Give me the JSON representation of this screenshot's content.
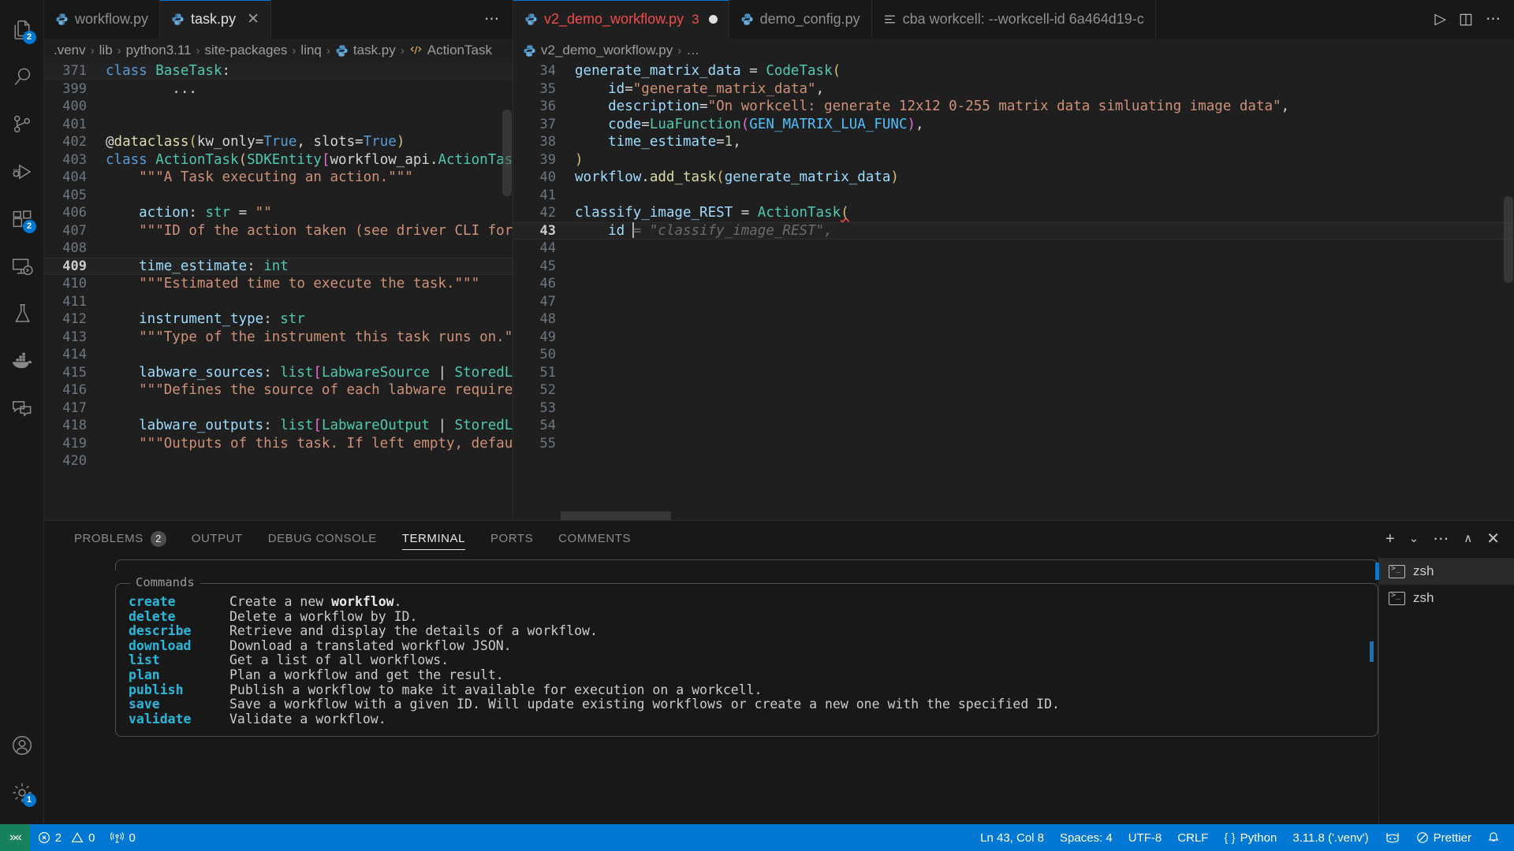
{
  "activity_bar": {
    "top_items": [
      {
        "name": "explorer",
        "icon": "files-icon",
        "badge": "2",
        "active": false
      },
      {
        "name": "search",
        "icon": "search-icon",
        "badge": null,
        "active": false
      },
      {
        "name": "source-control",
        "icon": "source-control-icon",
        "badge": null,
        "active": false
      },
      {
        "name": "run-and-debug",
        "icon": "run-debug-icon",
        "badge": null,
        "active": false
      },
      {
        "name": "extensions",
        "icon": "extensions-icon",
        "badge": "2",
        "active": false
      },
      {
        "name": "remote-explorer",
        "icon": "remote-explorer-icon",
        "badge": null,
        "active": false
      },
      {
        "name": "testing",
        "icon": "beaker-icon",
        "badge": null,
        "active": false
      },
      {
        "name": "docker",
        "icon": "docker-icon",
        "badge": null,
        "active": false
      },
      {
        "name": "chat",
        "icon": "chat-icon",
        "badge": null,
        "active": false
      }
    ],
    "bottom_items": [
      {
        "name": "accounts",
        "icon": "account-icon",
        "badge": null
      },
      {
        "name": "manage-settings",
        "icon": "gear-icon",
        "badge": "1"
      }
    ]
  },
  "left_group": {
    "tabs": [
      {
        "label": "workflow.py",
        "icon": "python-icon",
        "active": false,
        "dirty": false,
        "closable": false
      },
      {
        "label": "task.py",
        "icon": "python-icon",
        "active": true,
        "dirty": false,
        "closable": true,
        "close_glyph": "✕"
      }
    ],
    "overflow_glyph": "⋯",
    "breadcrumbs": [
      {
        "label": ".venv",
        "icon": null
      },
      {
        "label": "lib",
        "icon": null
      },
      {
        "label": "python3.11",
        "icon": null
      },
      {
        "label": "site-packages",
        "icon": null
      },
      {
        "label": "linq",
        "icon": null
      },
      {
        "label": "task.py",
        "icon": "python-icon"
      },
      {
        "label": "ActionTask",
        "icon": "class-icon"
      }
    ],
    "breadcrumb_separator": "›",
    "lines": [
      {
        "no": "371",
        "sticky": true,
        "tokens": [
          {
            "t": "class ",
            "c": "t-kw"
          },
          {
            "t": "BaseTask",
            "c": "t-cls"
          },
          {
            "t": ":",
            "c": "t-plain"
          }
        ]
      },
      {
        "no": "399",
        "tokens": [
          {
            "t": "        ...",
            "c": "t-plain"
          }
        ]
      },
      {
        "no": "400",
        "tokens": []
      },
      {
        "no": "401",
        "tokens": []
      },
      {
        "no": "402",
        "tokens": [
          {
            "t": "@",
            "c": "t-plain"
          },
          {
            "t": "dataclass",
            "c": "t-fn"
          },
          {
            "t": "(",
            "c": "t-par"
          },
          {
            "t": "kw_only",
            "c": "t-plain"
          },
          {
            "t": "=",
            "c": "t-plain"
          },
          {
            "t": "True",
            "c": "t-kw"
          },
          {
            "t": ", ",
            "c": "t-plain"
          },
          {
            "t": "slots",
            "c": "t-plain"
          },
          {
            "t": "=",
            "c": "t-plain"
          },
          {
            "t": "True",
            "c": "t-kw"
          },
          {
            "t": ")",
            "c": "t-par"
          }
        ]
      },
      {
        "no": "403",
        "tokens": [
          {
            "t": "class ",
            "c": "t-kw"
          },
          {
            "t": "ActionTask",
            "c": "t-cls"
          },
          {
            "t": "(",
            "c": "t-par"
          },
          {
            "t": "SDKEntity",
            "c": "t-cls"
          },
          {
            "t": "[",
            "c": "t-par2"
          },
          {
            "t": "workflow_api",
            "c": "t-plain"
          },
          {
            "t": ".",
            "c": "t-plain"
          },
          {
            "t": "ActionTaskInput",
            "c": "t-cls"
          },
          {
            "t": ",",
            "c": "t-plain"
          }
        ]
      },
      {
        "no": "404",
        "tokens": [
          {
            "t": "    \"\"\"A Task executing an action.\"\"\"",
            "c": "t-str"
          }
        ]
      },
      {
        "no": "405",
        "tokens": []
      },
      {
        "no": "406",
        "tokens": [
          {
            "t": "    action",
            "c": "t-var"
          },
          {
            "t": ": ",
            "c": "t-plain"
          },
          {
            "t": "str",
            "c": "t-cls"
          },
          {
            "t": " = ",
            "c": "t-plain"
          },
          {
            "t": "\"\"",
            "c": "t-str"
          }
        ]
      },
      {
        "no": "407",
        "tokens": [
          {
            "t": "    \"\"\"ID of the action taken (see driver CLI for possib",
            "c": "t-str"
          }
        ]
      },
      {
        "no": "408",
        "tokens": []
      },
      {
        "no": "409",
        "current": true,
        "tokens": [
          {
            "t": "    time_estimate",
            "c": "t-var"
          },
          {
            "t": ": ",
            "c": "t-plain"
          },
          {
            "t": "int",
            "c": "t-cls"
          }
        ]
      },
      {
        "no": "410",
        "tokens": [
          {
            "t": "    \"\"\"Estimated time to execute the task.\"\"\"",
            "c": "t-str"
          }
        ]
      },
      {
        "no": "411",
        "tokens": []
      },
      {
        "no": "412",
        "tokens": [
          {
            "t": "    instrument_type",
            "c": "t-var"
          },
          {
            "t": ": ",
            "c": "t-plain"
          },
          {
            "t": "str",
            "c": "t-cls"
          }
        ]
      },
      {
        "no": "413",
        "tokens": [
          {
            "t": "    \"\"\"Type of the instrument this task runs on.\"\"\"",
            "c": "t-str"
          }
        ]
      },
      {
        "no": "414",
        "tokens": []
      },
      {
        "no": "415",
        "tokens": [
          {
            "t": "    labware_sources",
            "c": "t-var"
          },
          {
            "t": ": ",
            "c": "t-plain"
          },
          {
            "t": "list",
            "c": "t-cls"
          },
          {
            "t": "[",
            "c": "t-par2"
          },
          {
            "t": "LabwareSource",
            "c": "t-cls"
          },
          {
            "t": " | ",
            "c": "t-plain"
          },
          {
            "t": "StoredLabware",
            "c": "t-cls"
          },
          {
            "t": "]",
            "c": "t-par2"
          }
        ]
      },
      {
        "no": "416",
        "tokens": [
          {
            "t": "    \"\"\"Defines the source of each labware required for th",
            "c": "t-str"
          }
        ]
      },
      {
        "no": "417",
        "tokens": []
      },
      {
        "no": "418",
        "tokens": [
          {
            "t": "    labware_outputs",
            "c": "t-var"
          },
          {
            "t": ": ",
            "c": "t-plain"
          },
          {
            "t": "list",
            "c": "t-cls"
          },
          {
            "t": "[",
            "c": "t-par2"
          },
          {
            "t": "LabwareOutput",
            "c": "t-cls"
          },
          {
            "t": " | ",
            "c": "t-plain"
          },
          {
            "t": "StoredLabware",
            "c": "t-cls"
          },
          {
            "t": "]",
            "c": "t-par2"
          }
        ]
      },
      {
        "no": "419",
        "tokens": [
          {
            "t": "    \"\"\"Outputs of this task. If left empty, defaults to ",
            "c": "t-str"
          }
        ]
      },
      {
        "no": "420",
        "tokens": []
      }
    ]
  },
  "right_group": {
    "tabs": [
      {
        "label": "v2_demo_workflow.py",
        "icon": "python-icon",
        "active": true,
        "dirty": true,
        "error_badge": "3"
      },
      {
        "label": "demo_config.py",
        "icon": "python-icon",
        "active": false,
        "dirty": false,
        "error_badge": null
      },
      {
        "label": "cba workcell: --workcell-id 6a464d19-c",
        "icon": "terminal-list-icon",
        "active": false,
        "dirty": false,
        "error_badge": null
      }
    ],
    "actions": [
      {
        "name": "run-python-file",
        "glyph": "▷"
      },
      {
        "name": "split-editor",
        "glyph": "◫"
      },
      {
        "name": "more-actions",
        "glyph": "⋯"
      }
    ],
    "breadcrumbs": [
      {
        "label": "v2_demo_workflow.py",
        "icon": "python-icon"
      },
      {
        "label": "…",
        "icon": null
      }
    ],
    "breadcrumb_separator": "›",
    "lines": [
      {
        "no": "34",
        "tokens": [
          {
            "t": "generate_matrix_data",
            "c": "t-var"
          },
          {
            "t": " = ",
            "c": "t-plain"
          },
          {
            "t": "CodeTask",
            "c": "t-cls"
          },
          {
            "t": "(",
            "c": "t-par"
          }
        ]
      },
      {
        "no": "35",
        "tokens": [
          {
            "t": "    id",
            "c": "t-var"
          },
          {
            "t": "=",
            "c": "t-plain"
          },
          {
            "t": "\"generate_matrix_data\"",
            "c": "t-str"
          },
          {
            "t": ",",
            "c": "t-plain"
          }
        ]
      },
      {
        "no": "36",
        "tokens": [
          {
            "t": "    description",
            "c": "t-var"
          },
          {
            "t": "=",
            "c": "t-plain"
          },
          {
            "t": "\"On workcell: generate 12x12 0-255 matrix data simluating image data\"",
            "c": "t-str"
          },
          {
            "t": ",",
            "c": "t-plain"
          }
        ]
      },
      {
        "no": "37",
        "tokens": [
          {
            "t": "    code",
            "c": "t-var"
          },
          {
            "t": "=",
            "c": "t-plain"
          },
          {
            "t": "LuaFunction",
            "c": "t-cls"
          },
          {
            "t": "(",
            "c": "t-par2"
          },
          {
            "t": "GEN_MATRIX_LUA_FUNC",
            "c": "t-const"
          },
          {
            "t": ")",
            "c": "t-par2"
          },
          {
            "t": ",",
            "c": "t-plain"
          }
        ]
      },
      {
        "no": "38",
        "tokens": [
          {
            "t": "    time_estimate",
            "c": "t-var"
          },
          {
            "t": "=",
            "c": "t-plain"
          },
          {
            "t": "1",
            "c": "t-num"
          },
          {
            "t": ",",
            "c": "t-plain"
          }
        ]
      },
      {
        "no": "39",
        "tokens": [
          {
            "t": ")",
            "c": "t-par"
          }
        ]
      },
      {
        "no": "40",
        "tokens": [
          {
            "t": "workflow",
            "c": "t-var"
          },
          {
            "t": ".",
            "c": "t-plain"
          },
          {
            "t": "add_task",
            "c": "t-fn"
          },
          {
            "t": "(",
            "c": "t-par"
          },
          {
            "t": "generate_matrix_data",
            "c": "t-var"
          },
          {
            "t": ")",
            "c": "t-par"
          }
        ]
      },
      {
        "no": "41",
        "tokens": []
      },
      {
        "no": "42",
        "tokens": [
          {
            "t": "classify_image_REST",
            "c": "t-var"
          },
          {
            "t": " = ",
            "c": "t-plain"
          },
          {
            "t": "ActionTask",
            "c": "t-cls"
          },
          {
            "t": "(",
            "c": "t-par squiggle"
          }
        ]
      },
      {
        "no": "43",
        "current": true,
        "tokens": [
          {
            "t": "    id ",
            "c": "t-var"
          }
        ],
        "cursor": true,
        "ghost": "= \"classify_image_REST\","
      },
      {
        "no": "44",
        "tokens": []
      },
      {
        "no": "45",
        "tokens": []
      },
      {
        "no": "46",
        "tokens": []
      },
      {
        "no": "47",
        "tokens": []
      },
      {
        "no": "48",
        "tokens": []
      },
      {
        "no": "49",
        "tokens": []
      },
      {
        "no": "50",
        "tokens": []
      },
      {
        "no": "51",
        "tokens": []
      },
      {
        "no": "52",
        "tokens": []
      },
      {
        "no": "53",
        "tokens": []
      },
      {
        "no": "54",
        "tokens": []
      },
      {
        "no": "55",
        "tokens": []
      }
    ]
  },
  "panel": {
    "tabs": [
      {
        "label": "PROBLEMS",
        "badge": "2",
        "active": false
      },
      {
        "label": "OUTPUT",
        "badge": null,
        "active": false
      },
      {
        "label": "DEBUG CONSOLE",
        "badge": null,
        "active": false
      },
      {
        "label": "TERMINAL",
        "badge": null,
        "active": true
      },
      {
        "label": "PORTS",
        "badge": null,
        "active": false
      },
      {
        "label": "COMMENTS",
        "badge": null,
        "active": false
      }
    ],
    "actions": [
      {
        "name": "new-terminal",
        "glyph": "+"
      },
      {
        "name": "terminal-profile-dropdown",
        "glyph": "⌄"
      },
      {
        "name": "terminal-more-actions",
        "glyph": "⋯"
      },
      {
        "name": "maximize-panel",
        "glyph": "∧"
      },
      {
        "name": "close-panel",
        "glyph": "✕"
      }
    ],
    "terminal": {
      "section_title": "Commands",
      "commands": [
        {
          "name": "create",
          "desc_pre": "Create a new ",
          "desc_bold": "workflow",
          "desc_post": "."
        },
        {
          "name": "delete",
          "desc_pre": "Delete a workflow by ID.",
          "desc_bold": "",
          "desc_post": ""
        },
        {
          "name": "describe",
          "desc_pre": "Retrieve and display the details of a workflow.",
          "desc_bold": "",
          "desc_post": ""
        },
        {
          "name": "download",
          "desc_pre": "Download a translated workflow JSON.",
          "desc_bold": "",
          "desc_post": ""
        },
        {
          "name": "list",
          "desc_pre": "Get a list of all workflows.",
          "desc_bold": "",
          "desc_post": ""
        },
        {
          "name": "plan",
          "desc_pre": "Plan a workflow and get the result.",
          "desc_bold": "",
          "desc_post": ""
        },
        {
          "name": "publish",
          "desc_pre": "Publish a workflow to make it available for execution on a workcell.",
          "desc_bold": "",
          "desc_post": ""
        },
        {
          "name": "save",
          "desc_pre": "Save a workflow with a given ID. Will update existing workflows or create a new one with the specified ID.",
          "desc_bold": "",
          "desc_post": ""
        },
        {
          "name": "validate",
          "desc_pre": "Validate a workflow.",
          "desc_bold": "",
          "desc_post": ""
        }
      ]
    },
    "terminal_tabs": [
      {
        "label": "zsh",
        "icon": "terminal-icon",
        "active": true
      },
      {
        "label": "zsh",
        "icon": "terminal-icon",
        "active": false
      }
    ]
  },
  "status_bar": {
    "remote_glyph": "»«",
    "left": [
      {
        "name": "errors-warnings",
        "errors": "2",
        "warnings": "0"
      },
      {
        "name": "radio-tower",
        "value": "0"
      }
    ],
    "right": [
      {
        "name": "cursor-position",
        "label": "Ln 43, Col 8"
      },
      {
        "name": "indentation",
        "label": "Spaces: 4"
      },
      {
        "name": "encoding",
        "label": "UTF-8"
      },
      {
        "name": "eol",
        "label": "CRLF"
      },
      {
        "name": "language-mode",
        "label": "Python",
        "prefix": "{ }"
      },
      {
        "name": "python-interpreter",
        "label": "3.11.8 ('.venv')"
      },
      {
        "name": "copilot-status",
        "label": "",
        "icon": "copilot-icon"
      },
      {
        "name": "prettier-formatter",
        "label": "Prettier",
        "icon": "prohibited-icon"
      },
      {
        "name": "notifications",
        "label": "",
        "icon": "bell-icon"
      }
    ]
  },
  "colors": {
    "accent": "#0078d4",
    "remote": "#16825d",
    "error": "#f14c4c",
    "editor_bg": "#1f1f1f",
    "chrome_bg": "#181818"
  }
}
